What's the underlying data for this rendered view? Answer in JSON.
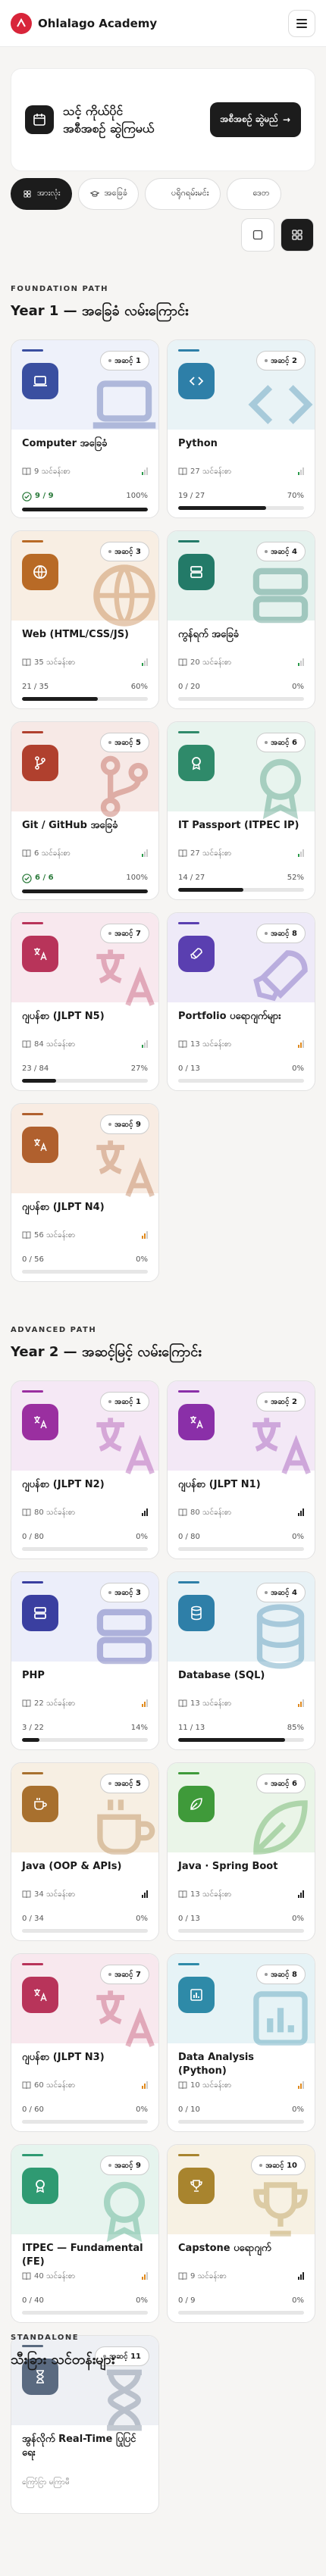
{
  "header": {
    "brand": "Ohlalago Academy"
  },
  "hero": {
    "text": "သင့် ကိုယ်ပိုင် အစီအစဉ် ဆွဲကြမယ်",
    "button": "အစီအစဉ် ဆွဲမည်",
    "button_arrow": "→"
  },
  "filters": [
    {
      "label": "အားလုံး",
      "icon": "grid-icon"
    },
    {
      "label": "အခြေခံ",
      "icon": "mortarboard-icon"
    },
    {
      "label": "ပရိုဂရမ်းမင်း",
      "icon": "code-icon"
    },
    {
      "label": "ဒေတ",
      "icon": "database-icon"
    }
  ],
  "sections": [
    {
      "label": "FOUNDATION PATH",
      "title": "Year 1 — အခြေခံ လမ်းကြောင်း",
      "cards": [
        {
          "step": "အဆင့် 1",
          "title": "Computer အခြေခံ",
          "lessons": "9 သင်ခန်းစာ",
          "level": 1,
          "progress": "9 / 9",
          "percent": "100%",
          "fill": 1.0,
          "done": true,
          "color": "#3a4fa0",
          "bg": "#eef1fa",
          "icon": "laptop-icon"
        },
        {
          "step": "အဆင့် 2",
          "title": "Python",
          "lessons": "27 သင်ခန်းစာ",
          "level": 1,
          "progress": "19 / 27",
          "percent": "70%",
          "fill": 0.7,
          "done": false,
          "color": "#2e7fa8",
          "bg": "#e9f3f6",
          "icon": "code-icon"
        },
        {
          "step": "အဆင့် 3",
          "title": "Web (HTML/CSS/JS)",
          "lessons": "35 သင်ခန်းစာ",
          "level": 1,
          "progress": "21 / 35",
          "percent": "60%",
          "fill": 0.6,
          "done": false,
          "color": "#b86a26",
          "bg": "#f8eee3",
          "icon": "globe-icon"
        },
        {
          "step": "အဆင့် 4",
          "title": "ကွန်ရက် အခြေခံ",
          "lessons": "20 သင်ခန်းစာ",
          "level": 1,
          "progress": "0 / 20",
          "percent": "0%",
          "fill": 0,
          "done": false,
          "color": "#237a68",
          "bg": "#e5f2ee",
          "icon": "server-icon"
        },
        {
          "step": "အဆင့် 5",
          "title": "Git / GitHub အခြေခံ",
          "lessons": "6 သင်ခန်းစာ",
          "level": 1,
          "progress": "6 / 6",
          "percent": "100%",
          "fill": 1.0,
          "done": true,
          "color": "#b0402e",
          "bg": "#f7e9e6",
          "icon": "git-branch-icon"
        },
        {
          "step": "အဆင့် 6",
          "title": "IT Passport (ITPEC IP)",
          "lessons": "27 သင်ခန်းစာ",
          "level": 1,
          "progress": "14 / 27",
          "percent": "52%",
          "fill": 0.52,
          "done": false,
          "color": "#2f8a6a",
          "bg": "#e8f4ee",
          "icon": "badge-icon"
        },
        {
          "step": "အဆင့် 7",
          "title": "ဂျပန်စာ (JLPT N5)",
          "lessons": "84 သင်ခန်းစာ",
          "level": 1,
          "progress": "23 / 84",
          "percent": "27%",
          "fill": 0.27,
          "done": false,
          "color": "#b8345a",
          "bg": "#f8e8ee",
          "icon": "translate-icon"
        },
        {
          "step": "အဆင့် 8",
          "title": "Portfolio ပရောဂျက်များ",
          "lessons": "13 သင်ခန်းစာ",
          "level": 2,
          "progress": "0 / 13",
          "percent": "0%",
          "fill": 0,
          "done": false,
          "color": "#5a3fb0",
          "bg": "#eeeaf8",
          "icon": "rocket-icon"
        },
        {
          "step": "အဆင့် 9",
          "title": "ဂျပန်စာ (JLPT N4)",
          "lessons": "56 သင်ခန်းစာ",
          "level": 2,
          "progress": "0 / 56",
          "percent": "0%",
          "fill": 0,
          "done": false,
          "color": "#b0602e",
          "bg": "#f8ece3",
          "icon": "translate-icon"
        }
      ]
    },
    {
      "label": "ADVANCED PATH",
      "title": "Year 2 — အဆင့်မြင့် လမ်းကြောင်း",
      "cards": [
        {
          "step": "အဆင့် 1",
          "title": "ဂျပန်စာ (JLPT N2)",
          "lessons": "80 သင်ခန်းစာ",
          "level": 3,
          "progress": "0 / 80",
          "percent": "0%",
          "fill": 0,
          "done": false,
          "color": "#9a2fa0",
          "bg": "#f5e8f5",
          "icon": "translate-icon"
        },
        {
          "step": "အဆင့် 2",
          "title": "ဂျပန်စာ (JLPT N1)",
          "lessons": "80 သင်ခန်းစာ",
          "level": 3,
          "progress": "0 / 80",
          "percent": "0%",
          "fill": 0,
          "done": false,
          "color": "#8a2fa8",
          "bg": "#f3e8f6",
          "icon": "translate-icon"
        },
        {
          "step": "အဆင့် 3",
          "title": "PHP",
          "lessons": "22 သင်ခန်းစာ",
          "level": 2,
          "progress": "3 / 22",
          "percent": "14%",
          "fill": 0.14,
          "done": false,
          "color": "#3a3fa0",
          "bg": "#eceefa",
          "icon": "server-icon"
        },
        {
          "step": "အဆင့် 4",
          "title": "Database (SQL)",
          "lessons": "13 သင်ခန်းစာ",
          "level": 2,
          "progress": "11 / 13",
          "percent": "85%",
          "fill": 0.85,
          "done": false,
          "color": "#2e7fa8",
          "bg": "#e8f2f6",
          "icon": "database-icon"
        },
        {
          "step": "အဆင့် 5",
          "title": "Java (OOP & APIs)",
          "lessons": "34 သင်ခန်းစာ",
          "level": 3,
          "progress": "0 / 34",
          "percent": "0%",
          "fill": 0,
          "done": false,
          "color": "#a8702e",
          "bg": "#f7efe3",
          "icon": "coffee-icon"
        },
        {
          "step": "အဆင့် 6",
          "title": "Java · Spring Boot",
          "lessons": "13 သင်ခန်းစာ",
          "level": 3,
          "progress": "0 / 13",
          "percent": "0%",
          "fill": 0,
          "done": false,
          "color": "#3f9a3a",
          "bg": "#eaf5e8",
          "icon": "leaf-icon"
        },
        {
          "step": "အဆင့် 7",
          "title": "ဂျပန်စာ (JLPT N3)",
          "lessons": "60 သင်ခန်းစာ",
          "level": 2,
          "progress": "0 / 60",
          "percent": "0%",
          "fill": 0,
          "done": false,
          "color": "#b8345a",
          "bg": "#f8e8ee",
          "icon": "translate-icon"
        },
        {
          "step": "အဆင့် 8",
          "title": "Data Analysis (Python)",
          "lessons": "10 သင်ခန်းစာ",
          "level": 2,
          "progress": "0 / 10",
          "percent": "0%",
          "fill": 0,
          "done": false,
          "color": "#2e8aa8",
          "bg": "#e6f3f6",
          "icon": "chart-icon"
        },
        {
          "step": "အဆင့် 9",
          "title": "ITPEC — Fundamental (FE)",
          "lessons": "40 သင်ခန်းစာ",
          "level": 2,
          "progress": "0 / 40",
          "percent": "0%",
          "fill": 0,
          "done": false,
          "color": "#2f9a72",
          "bg": "#e6f4ee",
          "icon": "badge-icon"
        },
        {
          "step": "အဆင့် 10",
          "title": "Capstone ပရောဂျက်",
          "lessons": "9 သင်ခန်းစာ",
          "level": 3,
          "progress": "0 / 9",
          "percent": "0%",
          "fill": 0,
          "done": false,
          "color": "#a8842e",
          "bg": "#f7f1e3",
          "icon": "trophy-icon"
        },
        {
          "step": "အဆင့် 11",
          "title": "အွန်လိုက် Real-Time ပြုပြင်ရေး",
          "lessons": "",
          "level": 0,
          "note": "ကြော်ငြာ မကြာမီ",
          "progress": "",
          "percent": "",
          "fill": 0,
          "done": false,
          "color": "#5a6a80",
          "bg": "#eef0f4",
          "icon": "hourglass-icon"
        }
      ]
    },
    {
      "label": "STANDALONE",
      "title": "သီးခြား သင်တန်းများ",
      "cards": []
    }
  ],
  "colors": {
    "accent_dark": "#1c1c1c",
    "brand_red": "#d8253a",
    "done_green": "#2a7a3a"
  }
}
